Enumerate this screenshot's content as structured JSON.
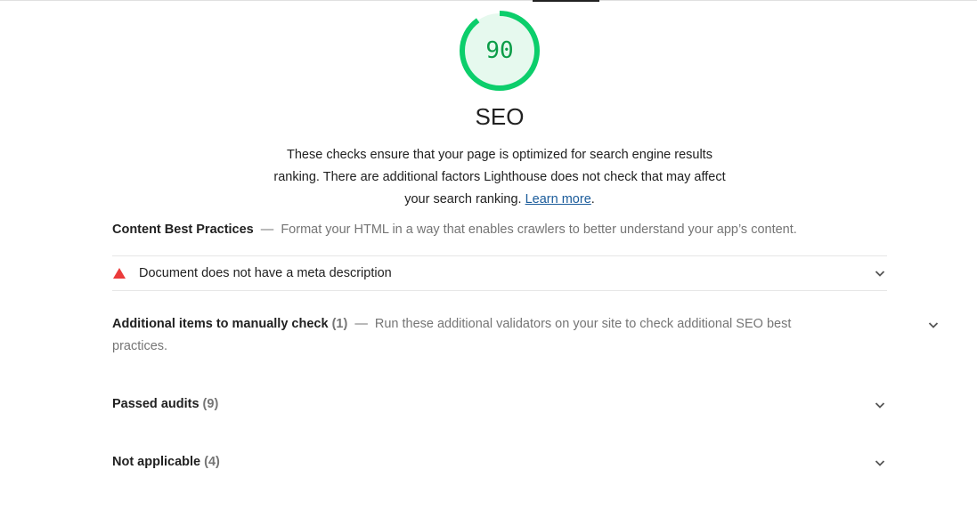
{
  "score": {
    "value": "90",
    "fraction": 0.9,
    "color": "#0cce6b",
    "track_color": "#e6f9ee"
  },
  "category": {
    "title": "SEO",
    "description_text": "These checks ensure that your page is optimized for search engine results ranking. There are additional factors Lighthouse does not check that may affect your search ranking.",
    "learn_more": "Learn more",
    "trailing_period": "."
  },
  "groups": {
    "content_best_practices": {
      "title": "Content Best Practices",
      "dash": "—",
      "description": "Format your HTML in a way that enables crawlers to better understand your app’s content."
    },
    "failed_audit": {
      "title": "Document does not have a meta description",
      "status_color": "#eb3b3b",
      "icon": "warning-triangle-icon"
    },
    "manual": {
      "title": "Additional items to manually check",
      "count": "(1)",
      "dash": "—",
      "description": "Run these additional validators on your site to check additional SEO best practices."
    },
    "passed": {
      "title": "Passed audits",
      "count": "(9)"
    },
    "not_applicable": {
      "title": "Not applicable",
      "count": "(4)"
    }
  },
  "icons": {
    "chevron": "chevron-down-icon"
  }
}
